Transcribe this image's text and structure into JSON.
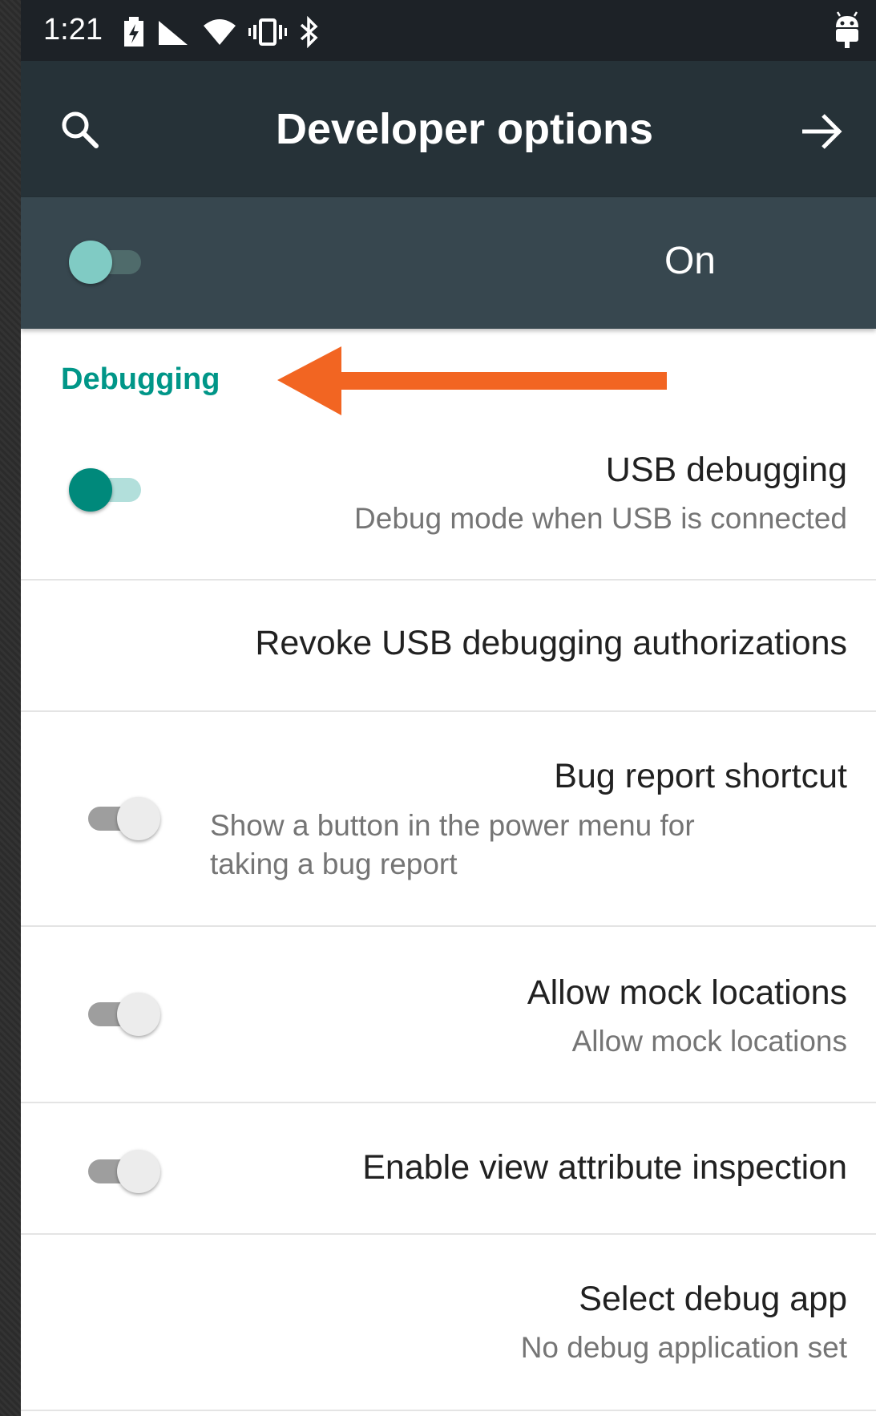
{
  "status_bar": {
    "time": "1:21",
    "icons": [
      "battery-charging-icon",
      "signal-icon",
      "wifi-icon",
      "vibrate-icon",
      "bluetooth-icon",
      "android-debug-icon"
    ]
  },
  "toolbar": {
    "title": "Developer options",
    "search_icon": "search-icon",
    "next_icon": "arrow-forward-icon"
  },
  "master_switch": {
    "label": "On",
    "checked": true
  },
  "section": {
    "header": "Debugging",
    "annotation_arrow_color": "#f26522"
  },
  "preferences": [
    {
      "title": "USB debugging",
      "summary": "Debug mode when USB is connected",
      "switch": true,
      "checked": true
    },
    {
      "title": "Revoke USB debugging authorizations",
      "summary": "",
      "switch": false
    },
    {
      "title": "Bug report shortcut",
      "summary": "Show a button in the power menu for taking a bug report",
      "switch": true,
      "checked": false
    },
    {
      "title": "Allow mock locations",
      "summary": "Allow mock locations",
      "switch": true,
      "checked": false
    },
    {
      "title": "Enable view attribute inspection",
      "summary": "",
      "switch": true,
      "checked": false
    },
    {
      "title": "Select debug app",
      "summary": "No debug application set",
      "switch": false
    }
  ],
  "colors": {
    "accent": "#009688",
    "toolbar": "#263238",
    "master_bar": "#37474f",
    "status_bar": "#1d2227"
  }
}
